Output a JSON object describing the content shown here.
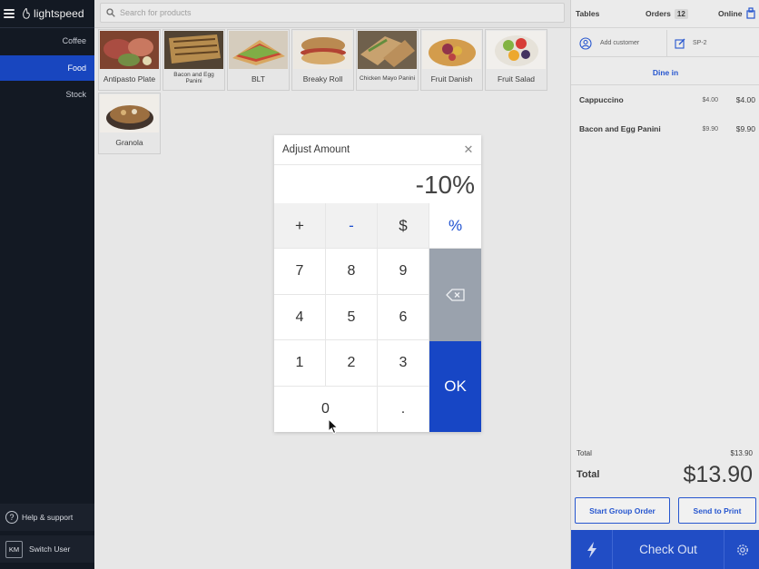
{
  "app": {
    "brand": "lightspeed"
  },
  "sidebar": {
    "categories": [
      {
        "label": "Coffee",
        "active": false
      },
      {
        "label": "Food",
        "active": true
      },
      {
        "label": "Stock",
        "active": false
      }
    ],
    "help_label": "Help & support",
    "user_initials": "KM",
    "switch_user_label": "Switch User"
  },
  "search": {
    "placeholder": "Search for products"
  },
  "products": [
    {
      "name": "Antipasto Plate",
      "icon": "antipasto-photo"
    },
    {
      "name": "Bacon and Egg Panini",
      "icon": "panini-photo"
    },
    {
      "name": "BLT",
      "icon": "blt-photo"
    },
    {
      "name": "Breaky Roll",
      "icon": "roll-photo"
    },
    {
      "name": "Chicken Mayo Panini",
      "icon": "chicken-panini-photo"
    },
    {
      "name": "Fruit Danish",
      "icon": "danish-photo"
    },
    {
      "name": "Fruit Salad",
      "icon": "fruit-salad-photo"
    },
    {
      "name": "Granola",
      "icon": "granola-photo"
    }
  ],
  "modal": {
    "title": "Adjust Amount",
    "display_value": "-10%",
    "operators": [
      "+",
      "-",
      "$",
      "%"
    ],
    "digits": [
      "7",
      "8",
      "9",
      "4",
      "5",
      "6",
      "1",
      "2",
      "3",
      "0",
      "."
    ],
    "ok_label": "OK"
  },
  "order": {
    "tables_label": "Tables",
    "orders_label": "Orders",
    "orders_count": "12",
    "online_label": "Online",
    "add_customer_label": "Add customer",
    "table_code": "SP-2",
    "dine_in_label": "Dine in",
    "lines": [
      {
        "name": "Cappuccino",
        "unit": "$4.00",
        "total": "$4.00"
      },
      {
        "name": "Bacon and Egg Panini",
        "unit": "$9.90",
        "total": "$9.90"
      }
    ],
    "subtotal_label": "Total",
    "subtotal_value": "$13.90",
    "total_label": "Total",
    "total_value": "$13.90",
    "group_order_label": "Start Group Order",
    "send_print_label": "Send to Print",
    "checkout_label": "Check Out"
  },
  "colors": {
    "accent": "#1746c5",
    "sidebar_bg": "#131923"
  }
}
